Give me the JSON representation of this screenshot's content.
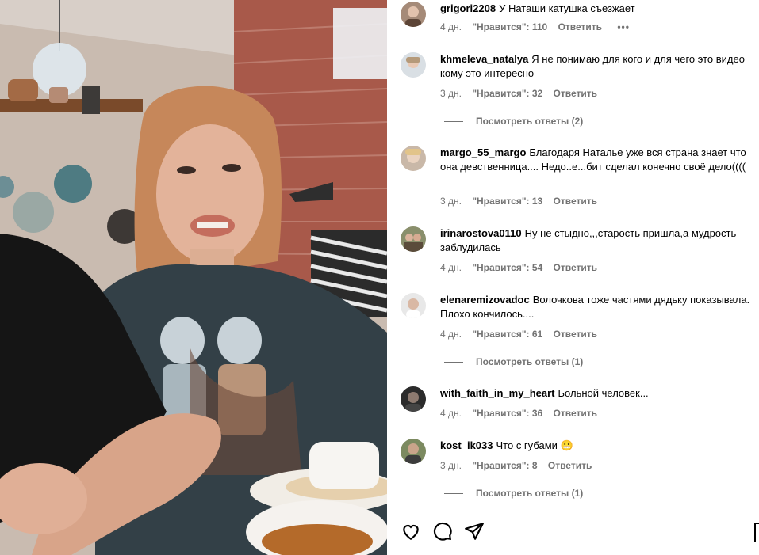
{
  "comments": [
    {
      "username": "grigori2208",
      "text": "У Наташи катушка съезжает",
      "time": "4 дн.",
      "likes": "\"Нравится\": 110",
      "reply": "Ответить",
      "more": "•••"
    },
    {
      "username": "khmeleva_natalya",
      "text": "Я не понимаю для кого и для чего это видео кому это интересно",
      "time": "3 дн.",
      "likes": "\"Нравится\": 32",
      "reply": "Ответить",
      "replies_link": "Посмотреть ответы (2)"
    },
    {
      "username": "margo_55_margo",
      "text": "Благодаря Наталье уже вся страна знает что она девственница.... Недо..е...бит сделал конечно своё дело((((",
      "time": "3 дн.",
      "likes": "\"Нравится\": 13",
      "reply": "Ответить"
    },
    {
      "username": "irinarostova0110",
      "text": "Ну не стыдно,,,старость пришла,а мудрость заблудилась",
      "time": "4 дн.",
      "likes": "\"Нравится\": 54",
      "reply": "Ответить"
    },
    {
      "username": "elenaremizovadoc",
      "text": "Волочкова тоже частями дядьку показывала. Плохо кончилось....",
      "time": "4 дн.",
      "likes": "\"Нравится\": 61",
      "reply": "Ответить",
      "replies_link": "Посмотреть ответы (1)"
    },
    {
      "username": "with_faith_in_my_heart",
      "text": "Больной человек...",
      "time": "4 дн.",
      "likes": "\"Нравится\": 36",
      "reply": "Ответить"
    },
    {
      "username": "kost_ik033",
      "text": "Что с губами 😬",
      "time": "3 дн.",
      "likes": "\"Нравится\": 8",
      "reply": "Ответить",
      "replies_link": "Посмотреть ответы (1)"
    }
  ],
  "actions": {
    "like_icon": "heart-icon",
    "comment_icon": "comment-icon",
    "share_icon": "share-icon",
    "save_icon": "bookmark-icon"
  },
  "colors": {
    "meta_gray": "#737373",
    "text": "#000000",
    "background": "#ffffff"
  }
}
